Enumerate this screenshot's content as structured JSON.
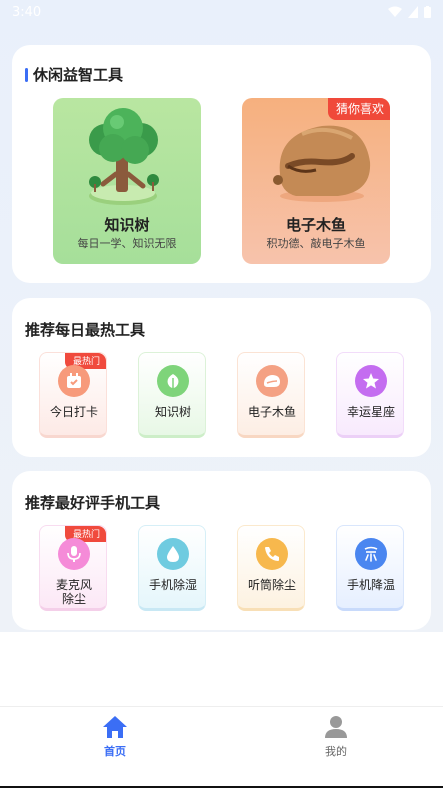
{
  "status_bar": {
    "time": "3:40"
  },
  "section_leisure": {
    "title": "休闲益智工具",
    "tiles": [
      {
        "name": "知识树",
        "desc": "每日一学、知识无限"
      },
      {
        "name": "电子木鱼",
        "desc": "积功德、敲电子木鱼",
        "badge": "猜你喜欢"
      }
    ]
  },
  "section_hot": {
    "title": "推荐每日最热工具",
    "tools": [
      {
        "label": "今日打卡",
        "badge": "最热门",
        "icon": "calendar-icon",
        "color": "#f79a7b"
      },
      {
        "label": "知识树",
        "icon": "leaf-icon",
        "color": "#7ed47a"
      },
      {
        "label": "电子木鱼",
        "icon": "wooden-fish-icon",
        "color": "#f4a183"
      },
      {
        "label": "幸运星座",
        "icon": "star-icon",
        "color": "#c46df0"
      }
    ]
  },
  "section_rated": {
    "title": "推荐最好评手机工具",
    "tools": [
      {
        "label": "麦克风\n除尘",
        "badge": "最热门",
        "icon": "microphone-icon",
        "color": "#f58bd8"
      },
      {
        "label": "手机除湿",
        "icon": "water-drop-icon",
        "color": "#6fcbe0"
      },
      {
        "label": "听筒除尘",
        "icon": "phone-icon",
        "color": "#f7b84d"
      },
      {
        "label": "手机降温",
        "icon": "cooling-icon",
        "color": "#4a86f0"
      }
    ]
  },
  "bottom_nav": {
    "home": {
      "label": "首页",
      "icon": "home-icon",
      "active_color": "#3b6ef5"
    },
    "me": {
      "label": "我的",
      "icon": "user-icon"
    }
  }
}
